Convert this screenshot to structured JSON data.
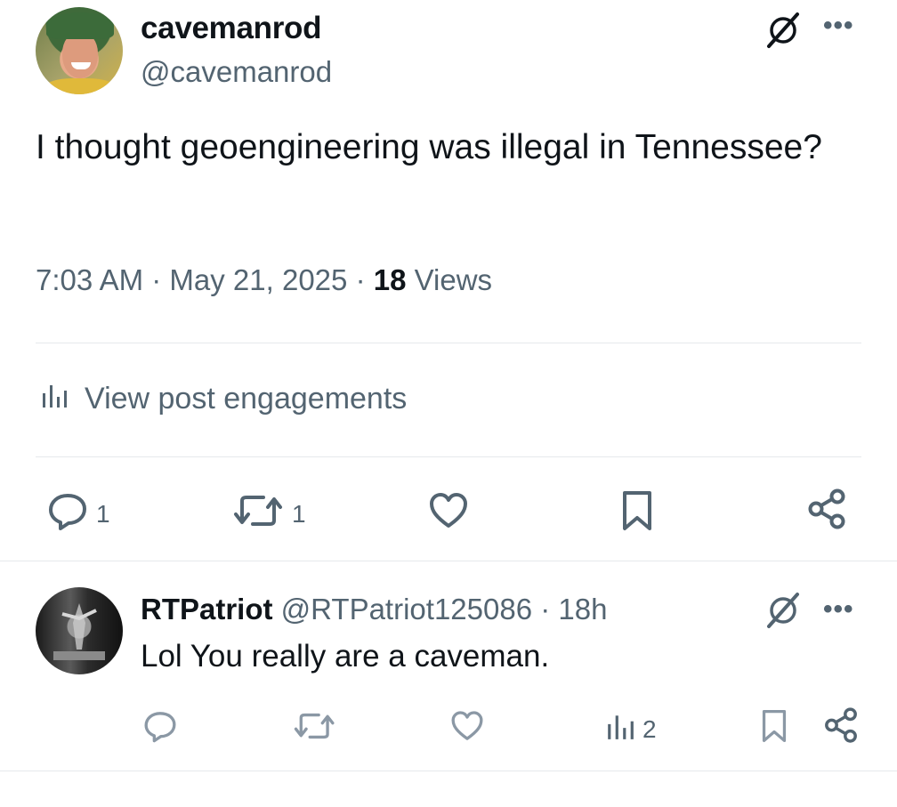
{
  "tweet": {
    "display_name": "cavemanrod",
    "handle": "@cavemanrod",
    "text": "I thought geoengineering was illegal in Tennessee?",
    "time": "7:03 AM",
    "date": "May 21, 2025",
    "views_count": "18",
    "views_label": "Views",
    "engagements_label": "View post engagements",
    "actions": {
      "reply_count": "1",
      "repost_count": "1"
    }
  },
  "reply": {
    "display_name": "RTPatriot",
    "handle": "@RTPatriot125086",
    "age": "18h",
    "text": "Lol You really are a caveman.",
    "views_count": "2"
  },
  "icons": {
    "grok": "grok-icon",
    "more": "more-icon",
    "reply": "reply-icon",
    "repost": "repost-icon",
    "like": "heart-icon",
    "bookmark": "bookmark-icon",
    "share": "share-icon",
    "views": "views-icon"
  },
  "colors": {
    "text": "#0f1419",
    "secondary": "#536471",
    "divider": "#e6e9ec"
  }
}
